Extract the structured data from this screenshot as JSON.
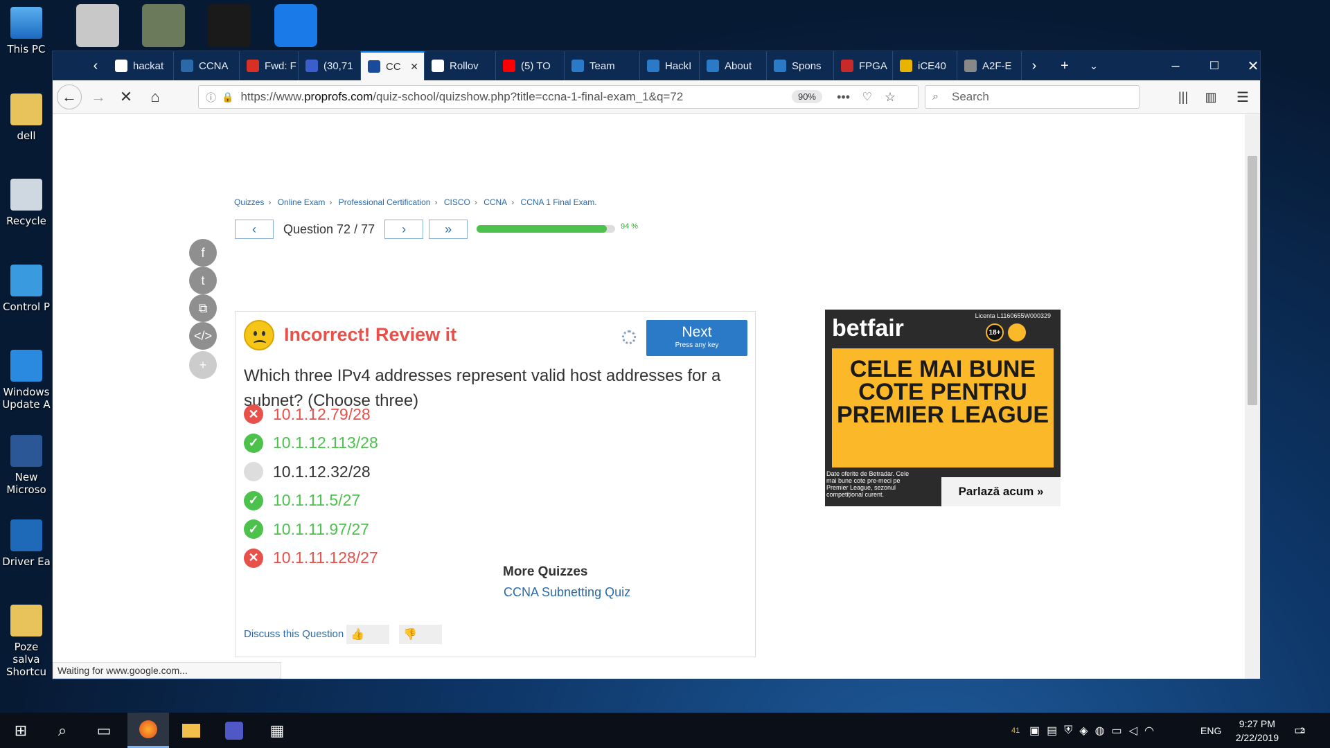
{
  "desktop": {
    "icons": [
      {
        "label": "This PC"
      },
      {
        "label": "dell"
      },
      {
        "label": "Recycle"
      },
      {
        "label": "Control P"
      },
      {
        "label": "Windows Update A"
      },
      {
        "label": "New Microso"
      },
      {
        "label": "Driver Ea"
      },
      {
        "label": "Poze salva Shortcu"
      }
    ]
  },
  "browser": {
    "tabs": [
      {
        "label": "hackat",
        "color": "#ffffff"
      },
      {
        "label": "CCNA",
        "color": "#2a6aa8"
      },
      {
        "label": "Fwd: F",
        "color": "#d93025"
      },
      {
        "label": "(30,71",
        "color": "#3a5fcd"
      },
      {
        "label": "CC",
        "color": "#1a4a9a",
        "active": true
      },
      {
        "label": "Rollov",
        "color": "#ffffff"
      },
      {
        "label": "(5) TO",
        "color": "#ff0000"
      },
      {
        "label": "Team",
        "color": "#2a7ac8"
      },
      {
        "label": "HackI",
        "color": "#2a7ac8"
      },
      {
        "label": "About",
        "color": "#2a7ac8"
      },
      {
        "label": "Spons",
        "color": "#2a7ac8"
      },
      {
        "label": "FPGA",
        "color": "#c82a2a"
      },
      {
        "label": "iCE40",
        "color": "#e8b400"
      },
      {
        "label": "A2F-E",
        "color": "#888888"
      }
    ],
    "url_prefix": "https://www.",
    "url_host": "proprofs.com",
    "url_path": "/quiz-school/quizshow.php?title=ccna-1-final-exam_1&q=72",
    "zoom": "90%",
    "search_placeholder": "Search",
    "status": "Waiting for www.google.com..."
  },
  "page": {
    "breadcrumb": [
      "Quizzes",
      "Online Exam",
      "Professional Certification",
      "CISCO",
      "CCNA",
      "CCNA 1 Final Exam."
    ],
    "question_label": "Question 72 / 77",
    "progress_percent": 94,
    "progress_text": "94 %",
    "verdict": "Incorrect! Review it",
    "next_label": "Next",
    "next_sub": "Press any key",
    "question": "Which three IPv4 addresses represent valid host addresses for a subnet? (Choose three)",
    "answers": [
      {
        "text": "10.1.12.79/28",
        "state": "wrong"
      },
      {
        "text": "10.1.12.113/28",
        "state": "right"
      },
      {
        "text": "10.1.12.32/28",
        "state": "none"
      },
      {
        "text": "10.1.11.5/27",
        "state": "right"
      },
      {
        "text": "10.1.11.97/27",
        "state": "right"
      },
      {
        "text": "10.1.11.128/27",
        "state": "wrong"
      }
    ],
    "discuss": "Discuss this Question",
    "more_title": "More Quizzes",
    "more_link": "CCNA Subnetting Quiz"
  },
  "ad": {
    "brand": "betfair",
    "license": "Licenta L1160655W000329",
    "age": "18+",
    "headline": "CELE MAI BUNE COTE PENTRU PREMIER LEAGUE",
    "fine_print": "Date oferite de Betradar. Cele mai bune cote pre-meci pe Premier League, sezonul competițional curent.",
    "cta": "Parlază acum »"
  },
  "taskbar": {
    "lang": "ENG",
    "time": "9:27 PM",
    "date": "2/22/2019",
    "notifications": "2",
    "tray_number": "41"
  }
}
